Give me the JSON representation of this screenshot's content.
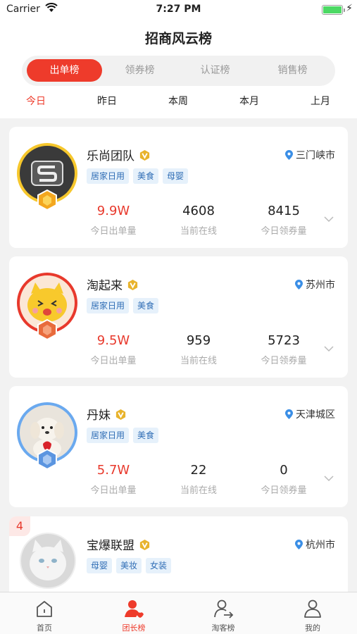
{
  "status_bar": {
    "carrier": "Carrier",
    "time": "7:27 PM"
  },
  "header": {
    "title": "招商风云榜",
    "segments": [
      "出单榜",
      "领券榜",
      "认证榜",
      "销售榜"
    ],
    "active_segment": "出单榜",
    "periods": [
      "今日",
      "昨日",
      "本周",
      "本月",
      "上月"
    ],
    "active_period": "今日"
  },
  "stat_labels": {
    "orders": "今日出单量",
    "online": "当前在线",
    "coupons": "今日领券量"
  },
  "cards": [
    {
      "name": "乐尚团队",
      "location": "三门峡市",
      "tags": [
        "居家日用",
        "美食",
        "母婴"
      ],
      "orders": "9.9W",
      "online": "4608",
      "coupons": "8415",
      "rank_medal": "gold"
    },
    {
      "name": "淘起来",
      "location": "苏州市",
      "tags": [
        "居家日用",
        "美食"
      ],
      "orders": "9.5W",
      "online": "959",
      "coupons": "5723",
      "rank_medal": "bronze"
    },
    {
      "name": "丹妹",
      "location": "天津城区",
      "tags": [
        "居家日用",
        "美食"
      ],
      "orders": "5.7W",
      "online": "22",
      "coupons": "0",
      "rank_medal": "silver"
    },
    {
      "name": "宝爆联盟",
      "location": "杭州市",
      "tags": [
        "母婴",
        "美妆",
        "女装"
      ],
      "rank": "4"
    }
  ],
  "tabbar": {
    "items": [
      {
        "label": "首页",
        "icon": "home-icon"
      },
      {
        "label": "团长榜",
        "icon": "leader-icon"
      },
      {
        "label": "淘客榜",
        "icon": "taoke-icon"
      },
      {
        "label": "我的",
        "icon": "profile-icon"
      }
    ],
    "active": "团长榜"
  },
  "colors": {
    "accent": "#ee3b2b",
    "tag_bg": "#e6f1fb",
    "tag_text": "#2f6db5",
    "pin": "#3a8ee6",
    "vip": "#e8b32c"
  }
}
